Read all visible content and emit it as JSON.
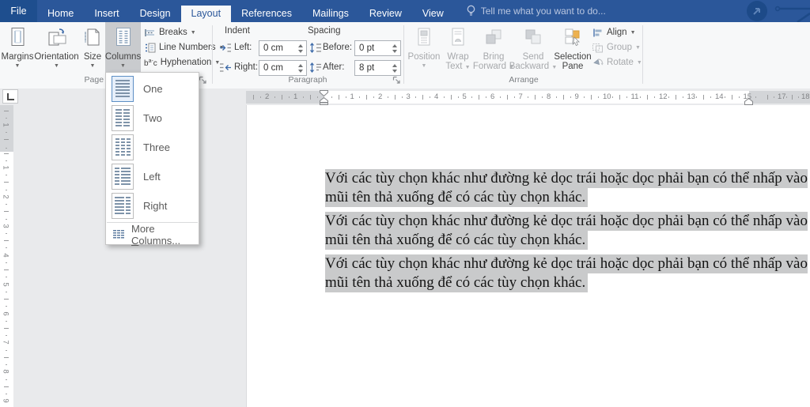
{
  "titlebar": {
    "file_tab": "File",
    "tabs": [
      {
        "label": "Home"
      },
      {
        "label": "Insert"
      },
      {
        "label": "Design"
      },
      {
        "label": "Layout",
        "active": true
      },
      {
        "label": "References"
      },
      {
        "label": "Mailings"
      },
      {
        "label": "Review"
      },
      {
        "label": "View"
      }
    ],
    "tell_me": "Tell me what you want to do..."
  },
  "ribbon": {
    "page_setup": {
      "label": "Page Setup",
      "margins": "Margins",
      "orientation": "Orientation",
      "size": "Size",
      "columns": "Columns",
      "breaks": "Breaks",
      "line_numbers": "Line Numbers",
      "hyphenation": "Hyphenation"
    },
    "paragraph": {
      "label": "Paragraph",
      "indent_header": "Indent",
      "left_label": "Left:",
      "left_value": "0 cm",
      "right_label": "Right:",
      "right_value": "0 cm",
      "spacing_header": "Spacing",
      "before_label": "Before:",
      "before_value": "0 pt",
      "after_label": "After:",
      "after_value": "8 pt"
    },
    "arrange": {
      "label": "Arrange",
      "position": "Position",
      "wrap_text_1": "Wrap",
      "wrap_text_2": "Text",
      "bring_1": "Bring",
      "bring_2": "Forward",
      "send_1": "Send",
      "send_2": "Backward",
      "selection_1": "Selection",
      "selection_2": "Pane",
      "align": "Align",
      "group": "Group",
      "rotate": "Rotate"
    }
  },
  "columns_menu": {
    "items": [
      {
        "label": "One",
        "icon": "columns-one-icon",
        "selected": true
      },
      {
        "label": "Two",
        "icon": "columns-two-icon"
      },
      {
        "label": "Three",
        "icon": "columns-three-icon"
      },
      {
        "label": "Left",
        "icon": "columns-left-icon"
      },
      {
        "label": "Right",
        "icon": "columns-right-icon"
      }
    ],
    "more_pre": "More ",
    "more_key": "C",
    "more_post": "olumns..."
  },
  "ruler": {
    "h_margin_left_numbers": [
      "1",
      "2"
    ],
    "h_numbers": [
      "1",
      "2",
      "3",
      "4",
      "5",
      "6",
      "7",
      "8",
      "9",
      "10",
      "11",
      "12",
      "13",
      "14",
      "15"
    ],
    "h_margin_right_numbers": [
      "17",
      "18"
    ],
    "v_margin_numbers": [
      "1"
    ],
    "v_numbers": [
      "1",
      "2",
      "3",
      "4",
      "5",
      "6",
      "7",
      "8",
      "9"
    ]
  },
  "document": {
    "paragraphs": [
      {
        "line1": "Với các tùy chọn khác như đường kẻ dọc trái hoặc dọc phải bạn có thể nhấp vào",
        "line2": "mũi tên thả xuống để có các tùy chọn khác."
      },
      {
        "line1": "Với các tùy chọn khác như đường kẻ dọc trái hoặc dọc phải bạn có thể nhấp vào",
        "line2": "mũi tên thả xuống để có các tùy chọn khác."
      },
      {
        "line1": "Với các tùy chọn khác như đường kẻ dọc trái hoặc dọc phải bạn có thể nhấp vào",
        "line2": "mũi tên thả xuống để có các tùy chọn khác."
      }
    ]
  },
  "colors": {
    "titlebar": "#2b579a",
    "accent": "#2b579a",
    "pressed_button": "#c9cbce",
    "selection_highlight": "#c9cacb",
    "selected_icon_border": "#5d8fc5"
  }
}
